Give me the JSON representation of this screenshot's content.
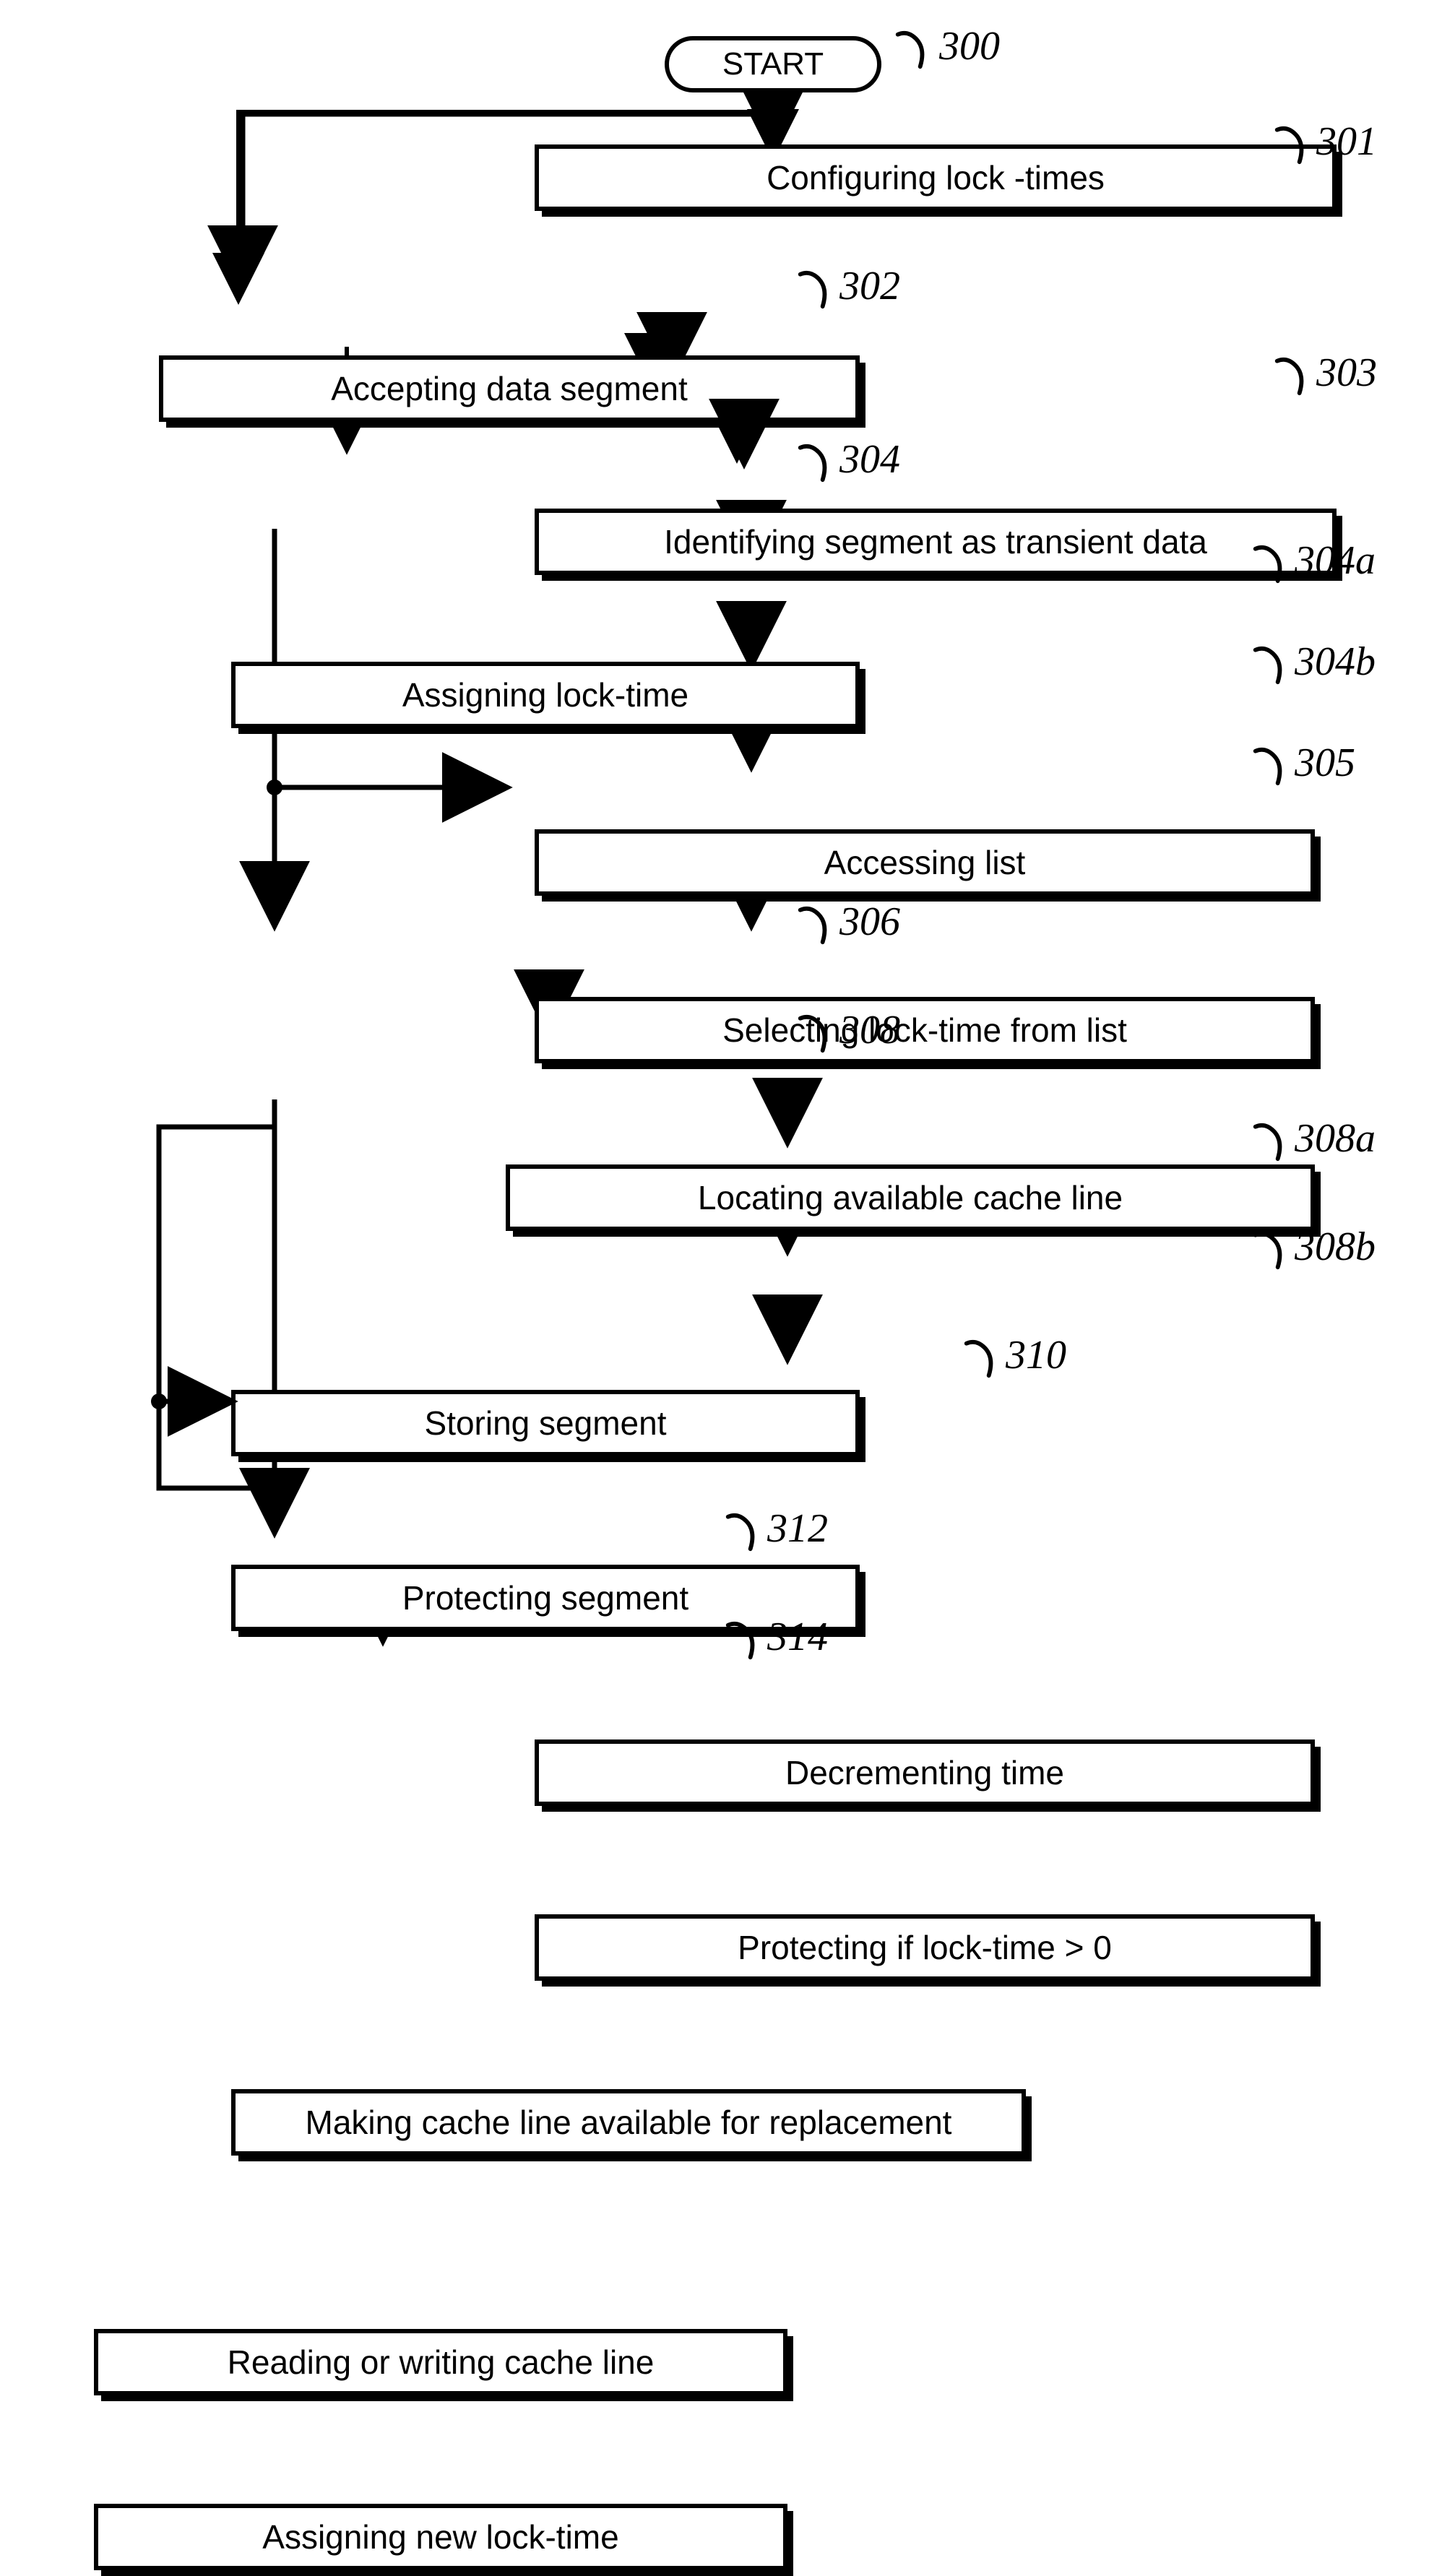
{
  "start_label": "START",
  "steps": {
    "s300": "300",
    "s301": {
      "label": "Configuring lock -times",
      "ref": "301"
    },
    "s302": {
      "label": "Accepting data segment",
      "ref": "302"
    },
    "s303": {
      "label": "Identifying segment as transient data",
      "ref": "303"
    },
    "s304": {
      "label": "Assigning lock-time",
      "ref": "304"
    },
    "s304a": {
      "label": "Accessing list",
      "ref": "304a"
    },
    "s304b": {
      "label": "Selecting lock-time from list",
      "ref": "304b"
    },
    "s305": {
      "label": "Locating available cache line",
      "ref": "305"
    },
    "s306": {
      "label": "Storing segment",
      "ref": "306"
    },
    "s308": {
      "label": "Protecting segment",
      "ref": "308"
    },
    "s308a": {
      "label": "Decrementing time",
      "ref": "308a"
    },
    "s308b": {
      "label": "Protecting if lock-time > 0",
      "ref": "308b"
    },
    "s310": {
      "label": "Making cache line available for replacement",
      "ref": "310"
    },
    "s312": {
      "label": "Reading or writing cache line",
      "ref": "312"
    },
    "s314": {
      "label": "Assigning new lock-time",
      "ref": "314"
    }
  }
}
